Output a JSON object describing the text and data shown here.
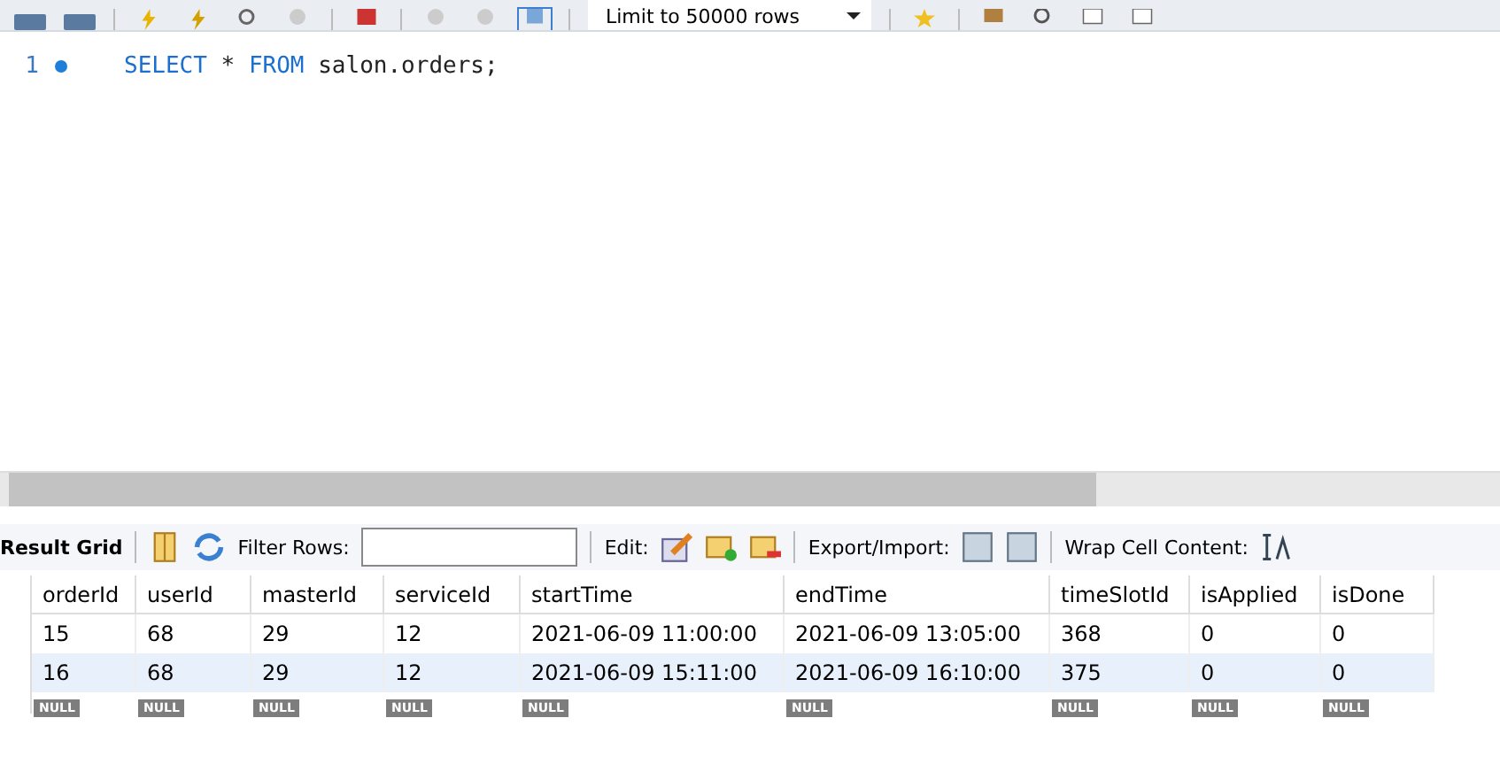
{
  "toolbar": {
    "limit_dropdown": "Limit to 50000 rows"
  },
  "editor": {
    "lines": [
      {
        "number": "1",
        "tokens": [
          {
            "kind": "keyword",
            "text": "SELECT"
          },
          {
            "kind": "plain",
            "text": "*"
          },
          {
            "kind": "keyword",
            "text": "FROM"
          },
          {
            "kind": "plain",
            "text": "salon.orders;"
          }
        ]
      }
    ]
  },
  "result_toolbar": {
    "title": "Result Grid",
    "filter_label": "Filter Rows:",
    "edit_label": "Edit:",
    "export_label": "Export/Import:",
    "wrap_label": "Wrap Cell Content:"
  },
  "table": {
    "columns": [
      "orderId",
      "userId",
      "masterId",
      "serviceId",
      "startTime",
      "endTime",
      "timeSlotId",
      "isApplied",
      "isDone"
    ],
    "rows": [
      [
        "15",
        "68",
        "29",
        "12",
        "2021-06-09 11:00:00",
        "2021-06-09 13:05:00",
        "368",
        "0",
        "0"
      ],
      [
        "16",
        "68",
        "29",
        "12",
        "2021-06-09 15:11:00",
        "2021-06-09 16:10:00",
        "375",
        "0",
        "0"
      ]
    ],
    "new_row": [
      "NULL",
      "NULL",
      "NULL",
      "NULL",
      "NULL",
      "NULL",
      "NULL",
      "NULL",
      "NULL"
    ]
  }
}
